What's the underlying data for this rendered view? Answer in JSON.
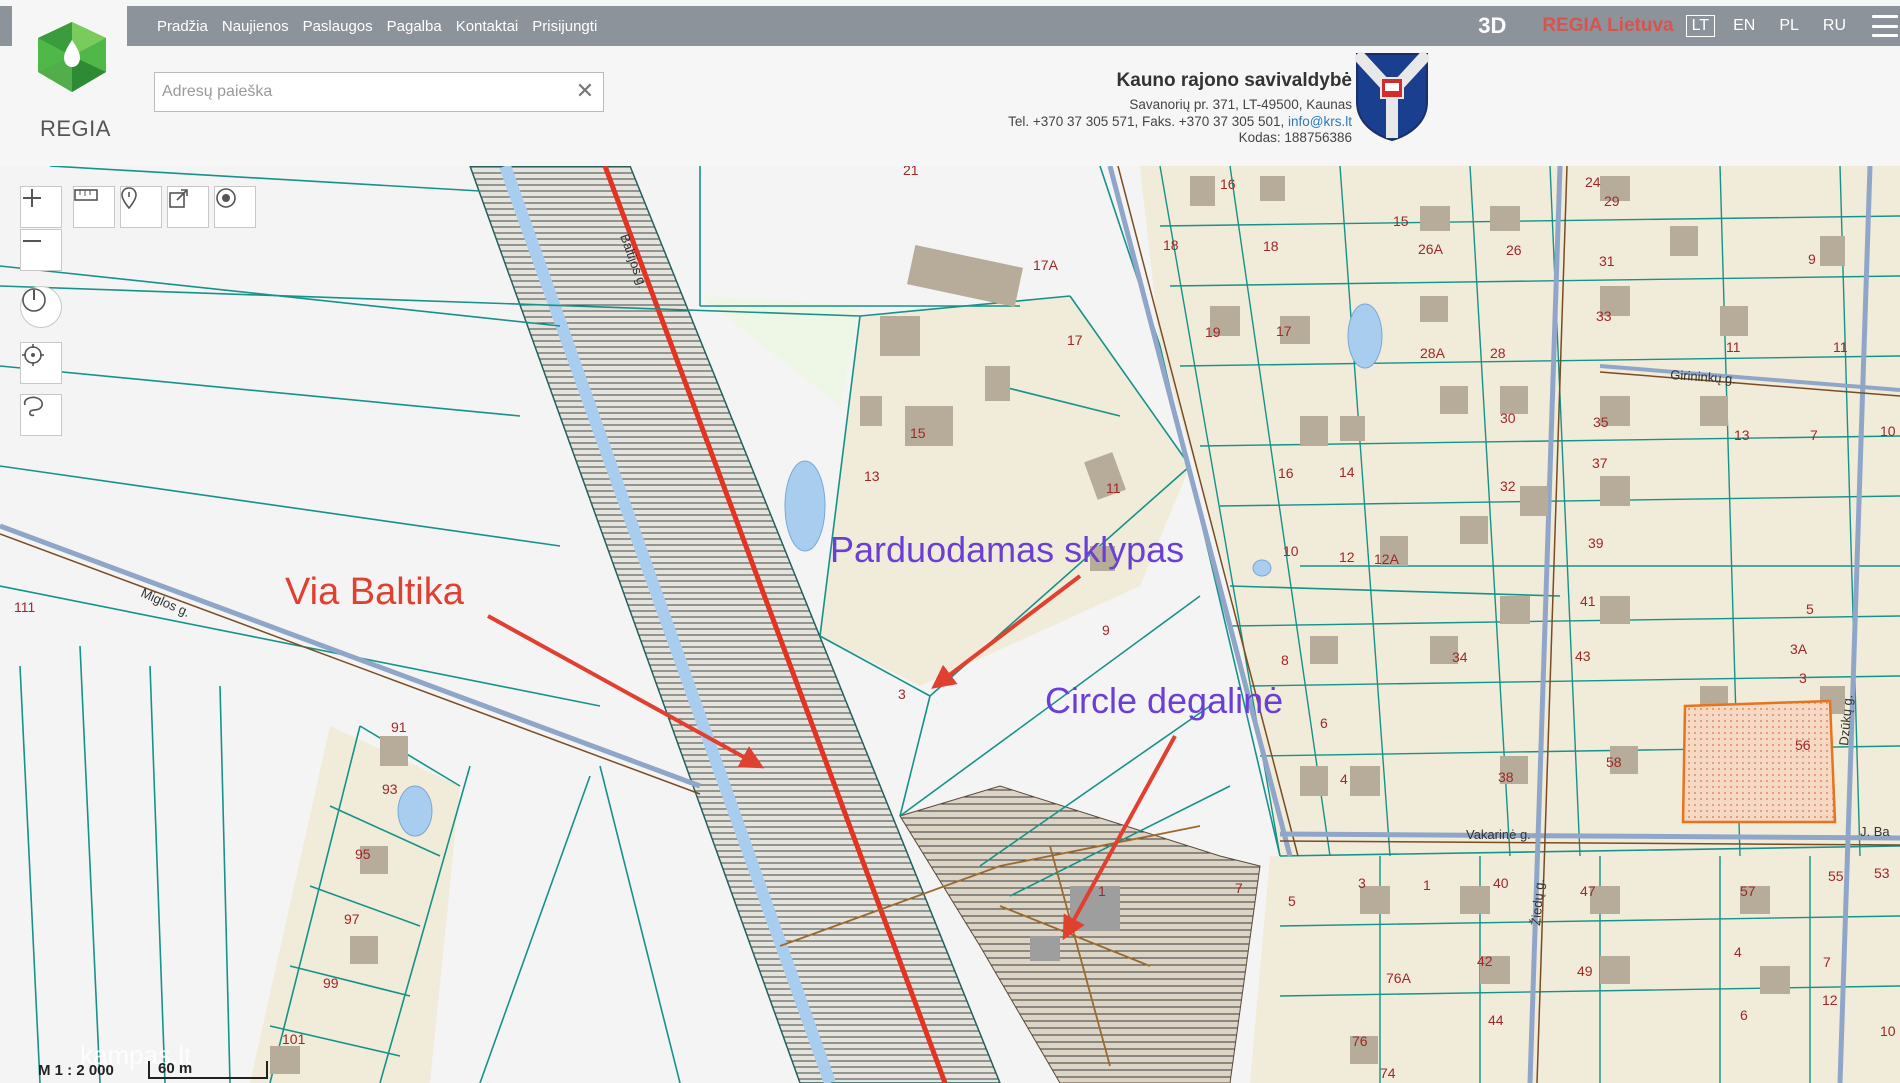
{
  "nav": {
    "items": [
      "Pradžia",
      "Naujienos",
      "Paslaugos",
      "Pagalba",
      "Kontaktai",
      "Prisijungti"
    ],
    "btn_3d": "3D",
    "regia_lietuva": "REGIA Lietuva",
    "languages": [
      {
        "code": "LT",
        "active": true
      },
      {
        "code": "EN",
        "active": false
      },
      {
        "code": "PL",
        "active": false
      },
      {
        "code": "RU",
        "active": false
      }
    ]
  },
  "logo": {
    "text": "REGIA"
  },
  "search": {
    "placeholder": "Adresų paieška",
    "value": ""
  },
  "municipality": {
    "name": "Kauno rajono savivaldybė",
    "address": "Savanorių pr. 371, LT-49500, Kaunas",
    "phone_line": "Tel. +370 37 305 571, Faks. +370 37 305 501, ",
    "email": "info@krs.lt",
    "code_line": "Kodas: 188756386"
  },
  "map": {
    "annotations": {
      "via_baltika": "Via Baltika",
      "parduodamas": "Parduodamas sklypas",
      "circle": "Circle degalinė"
    },
    "streets": {
      "migla": "Miglos g.",
      "girininku": "Girininkų g.",
      "vakarine": "Vakarinė g.",
      "dzuku": "Dzūkų g.",
      "ziedu": "Žiedų g.",
      "baltijos": "Baltijos g.",
      "j_ba": "J. Ba"
    },
    "parcel_labels": [
      "21",
      "17A",
      "17",
      "15",
      "13",
      "11",
      "9",
      "3",
      "1",
      "7",
      "5",
      "111",
      "91",
      "93",
      "95",
      "97",
      "99",
      "101",
      "16",
      "15",
      "18",
      "18",
      "19",
      "17",
      "28A",
      "28",
      "26A",
      "26",
      "24",
      "29",
      "31",
      "33",
      "30",
      "16",
      "14",
      "10",
      "12",
      "12A",
      "8",
      "6",
      "4",
      "34",
      "38",
      "32",
      "35",
      "37",
      "39",
      "41",
      "43",
      "58",
      "56",
      "3A",
      "3",
      "5",
      "13",
      "11",
      "9",
      "11",
      "7",
      "10",
      "47",
      "49",
      "42",
      "40",
      "57",
      "4",
      "7",
      "55",
      "53",
      "12",
      "10",
      "6",
      "1",
      "3",
      "76A",
      "44",
      "76",
      "74"
    ],
    "scale_text": "M 1 : 2 000",
    "scale_bar": "60 m",
    "watermark": "kampas.lt",
    "colors": {
      "parcel_fill": "#f1ebd9",
      "building": "#b7ab99",
      "parcel_line": "#16928a",
      "road": "#e23323",
      "water": "#a9cdee",
      "label": "#a02828",
      "annotation_red": "#e0402f",
      "annotation_purple": "#6a3fd8",
      "highlight": "#e8731d"
    }
  },
  "tools": [
    "zoom-in-icon",
    "zoom-out-icon",
    "ruler-icon",
    "pin-icon",
    "share-icon",
    "radio-icon",
    "compass-icon",
    "locate-icon",
    "lasso-icon"
  ]
}
